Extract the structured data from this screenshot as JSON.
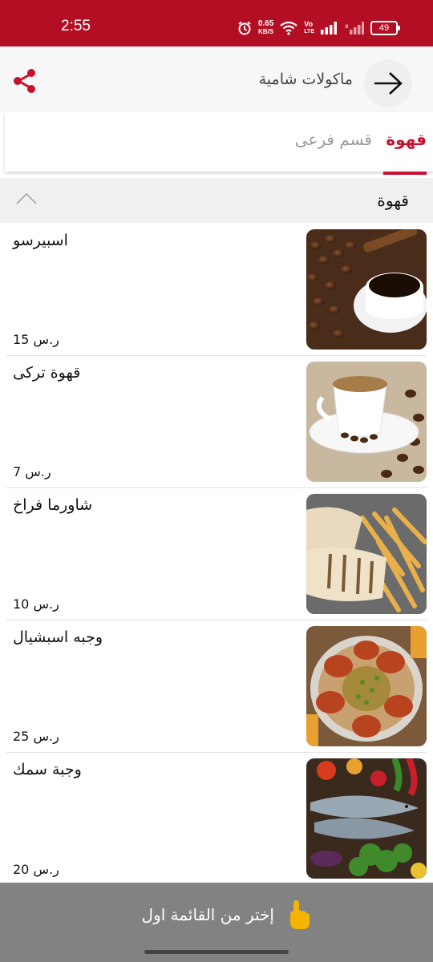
{
  "status_bar": {
    "time": "2:55",
    "net_speed_value": "0.65",
    "net_speed_unit": "KB/S",
    "volte_top": "Vo",
    "volte_bottom": "LTE",
    "battery": "49"
  },
  "app_bar": {
    "title": "ماكولات شامية",
    "back_icon": "arrow-right-icon",
    "share_icon": "share-icon"
  },
  "tabs": {
    "active": "قهوة",
    "sub": "قسم فرعى"
  },
  "section": {
    "title": "قهوة",
    "collapse_icon": "chevron-up-icon"
  },
  "items": [
    {
      "name": "اسبيرسو",
      "price": "15 ر.س"
    },
    {
      "name": "قهوة تركى",
      "price": "7 ر.س"
    },
    {
      "name": "شاورما فراخ",
      "price": "10 ر.س"
    },
    {
      "name": "وجبه اسبشيال",
      "price": "25 ر.س"
    },
    {
      "name": "وجبة سمك",
      "price": "20 ر.س"
    }
  ],
  "bottom_bar": {
    "text": "إختر من القائمة اول",
    "hand_icon": "pointing-hand-icon"
  },
  "colors": {
    "brand_red": "#c8102e",
    "status_red": "#b30e24",
    "toast_gray": "#828282"
  }
}
